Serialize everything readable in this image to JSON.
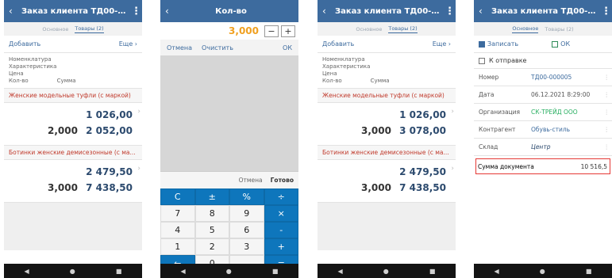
{
  "order_screen": {
    "title": "Заказ клиента ТД00-000005 0...",
    "tab_main": "Основное",
    "tab_goods": "Товары (2)",
    "add": "Добавить",
    "more": "Еще",
    "headers": [
      "Номенклатура",
      "Характеристика",
      "Цена"
    ],
    "header_qty": "Кол-во",
    "header_sum": "Сумма"
  },
  "screen1": {
    "items": [
      {
        "name": "Женские модельные туфли (с маркой)",
        "price": "1 026,00",
        "qty": "2,000",
        "sum": "2 052,00"
      },
      {
        "name": "Ботинки женские демисезонные (с ма...",
        "price": "2 479,50",
        "qty": "3,000",
        "sum": "7 438,50"
      }
    ]
  },
  "screen2": {
    "title": "Кол-во",
    "value": "3,000",
    "minus": "−",
    "plus": "+",
    "cancel": "Отмена",
    "clear": "Очистить",
    "ok": "ОК",
    "kb_cancel": "Отмена",
    "kb_done": "Готово",
    "keys": [
      "C",
      "±",
      "%",
      "÷",
      "7",
      "8",
      "9",
      "×",
      "4",
      "5",
      "6",
      "-",
      "1",
      "2",
      "3",
      "+",
      "←",
      "0",
      ".",
      "="
    ]
  },
  "screen3": {
    "items": [
      {
        "name": "Женские модельные туфли (с маркой)",
        "price": "1 026,00",
        "qty": "3,000",
        "sum": "3 078,00"
      },
      {
        "name": "Ботинки женские демисезонные (с ма...",
        "price": "2 479,50",
        "qty": "3,000",
        "sum": "7 438,50"
      }
    ]
  },
  "screen4": {
    "title": "Заказ клиента ТД00-000005 0...",
    "tab_main": "Основное",
    "tab_goods": "Товары (2)",
    "save": "Записать",
    "ok": "ОК",
    "send": "К отправке",
    "fields": [
      {
        "label": "Номер",
        "value": "ТД00-000005"
      },
      {
        "label": "Дата",
        "value": "06.12.2021 8:29:00"
      },
      {
        "label": "Организация",
        "value": "СК-ТРЕЙД ООО"
      },
      {
        "label": "Контрагент",
        "value": "Обувь-стиль"
      },
      {
        "label": "Склад",
        "value": "Центр"
      }
    ],
    "total_label": "Сумма документа",
    "total_value": "10 516,5"
  },
  "colors": {
    "appbar": "#3d6b9e",
    "accent_red": "#c0392b",
    "keypad_blue": "#0e76bc",
    "highlight": "#e53935",
    "qty_orange": "#f0a020"
  }
}
